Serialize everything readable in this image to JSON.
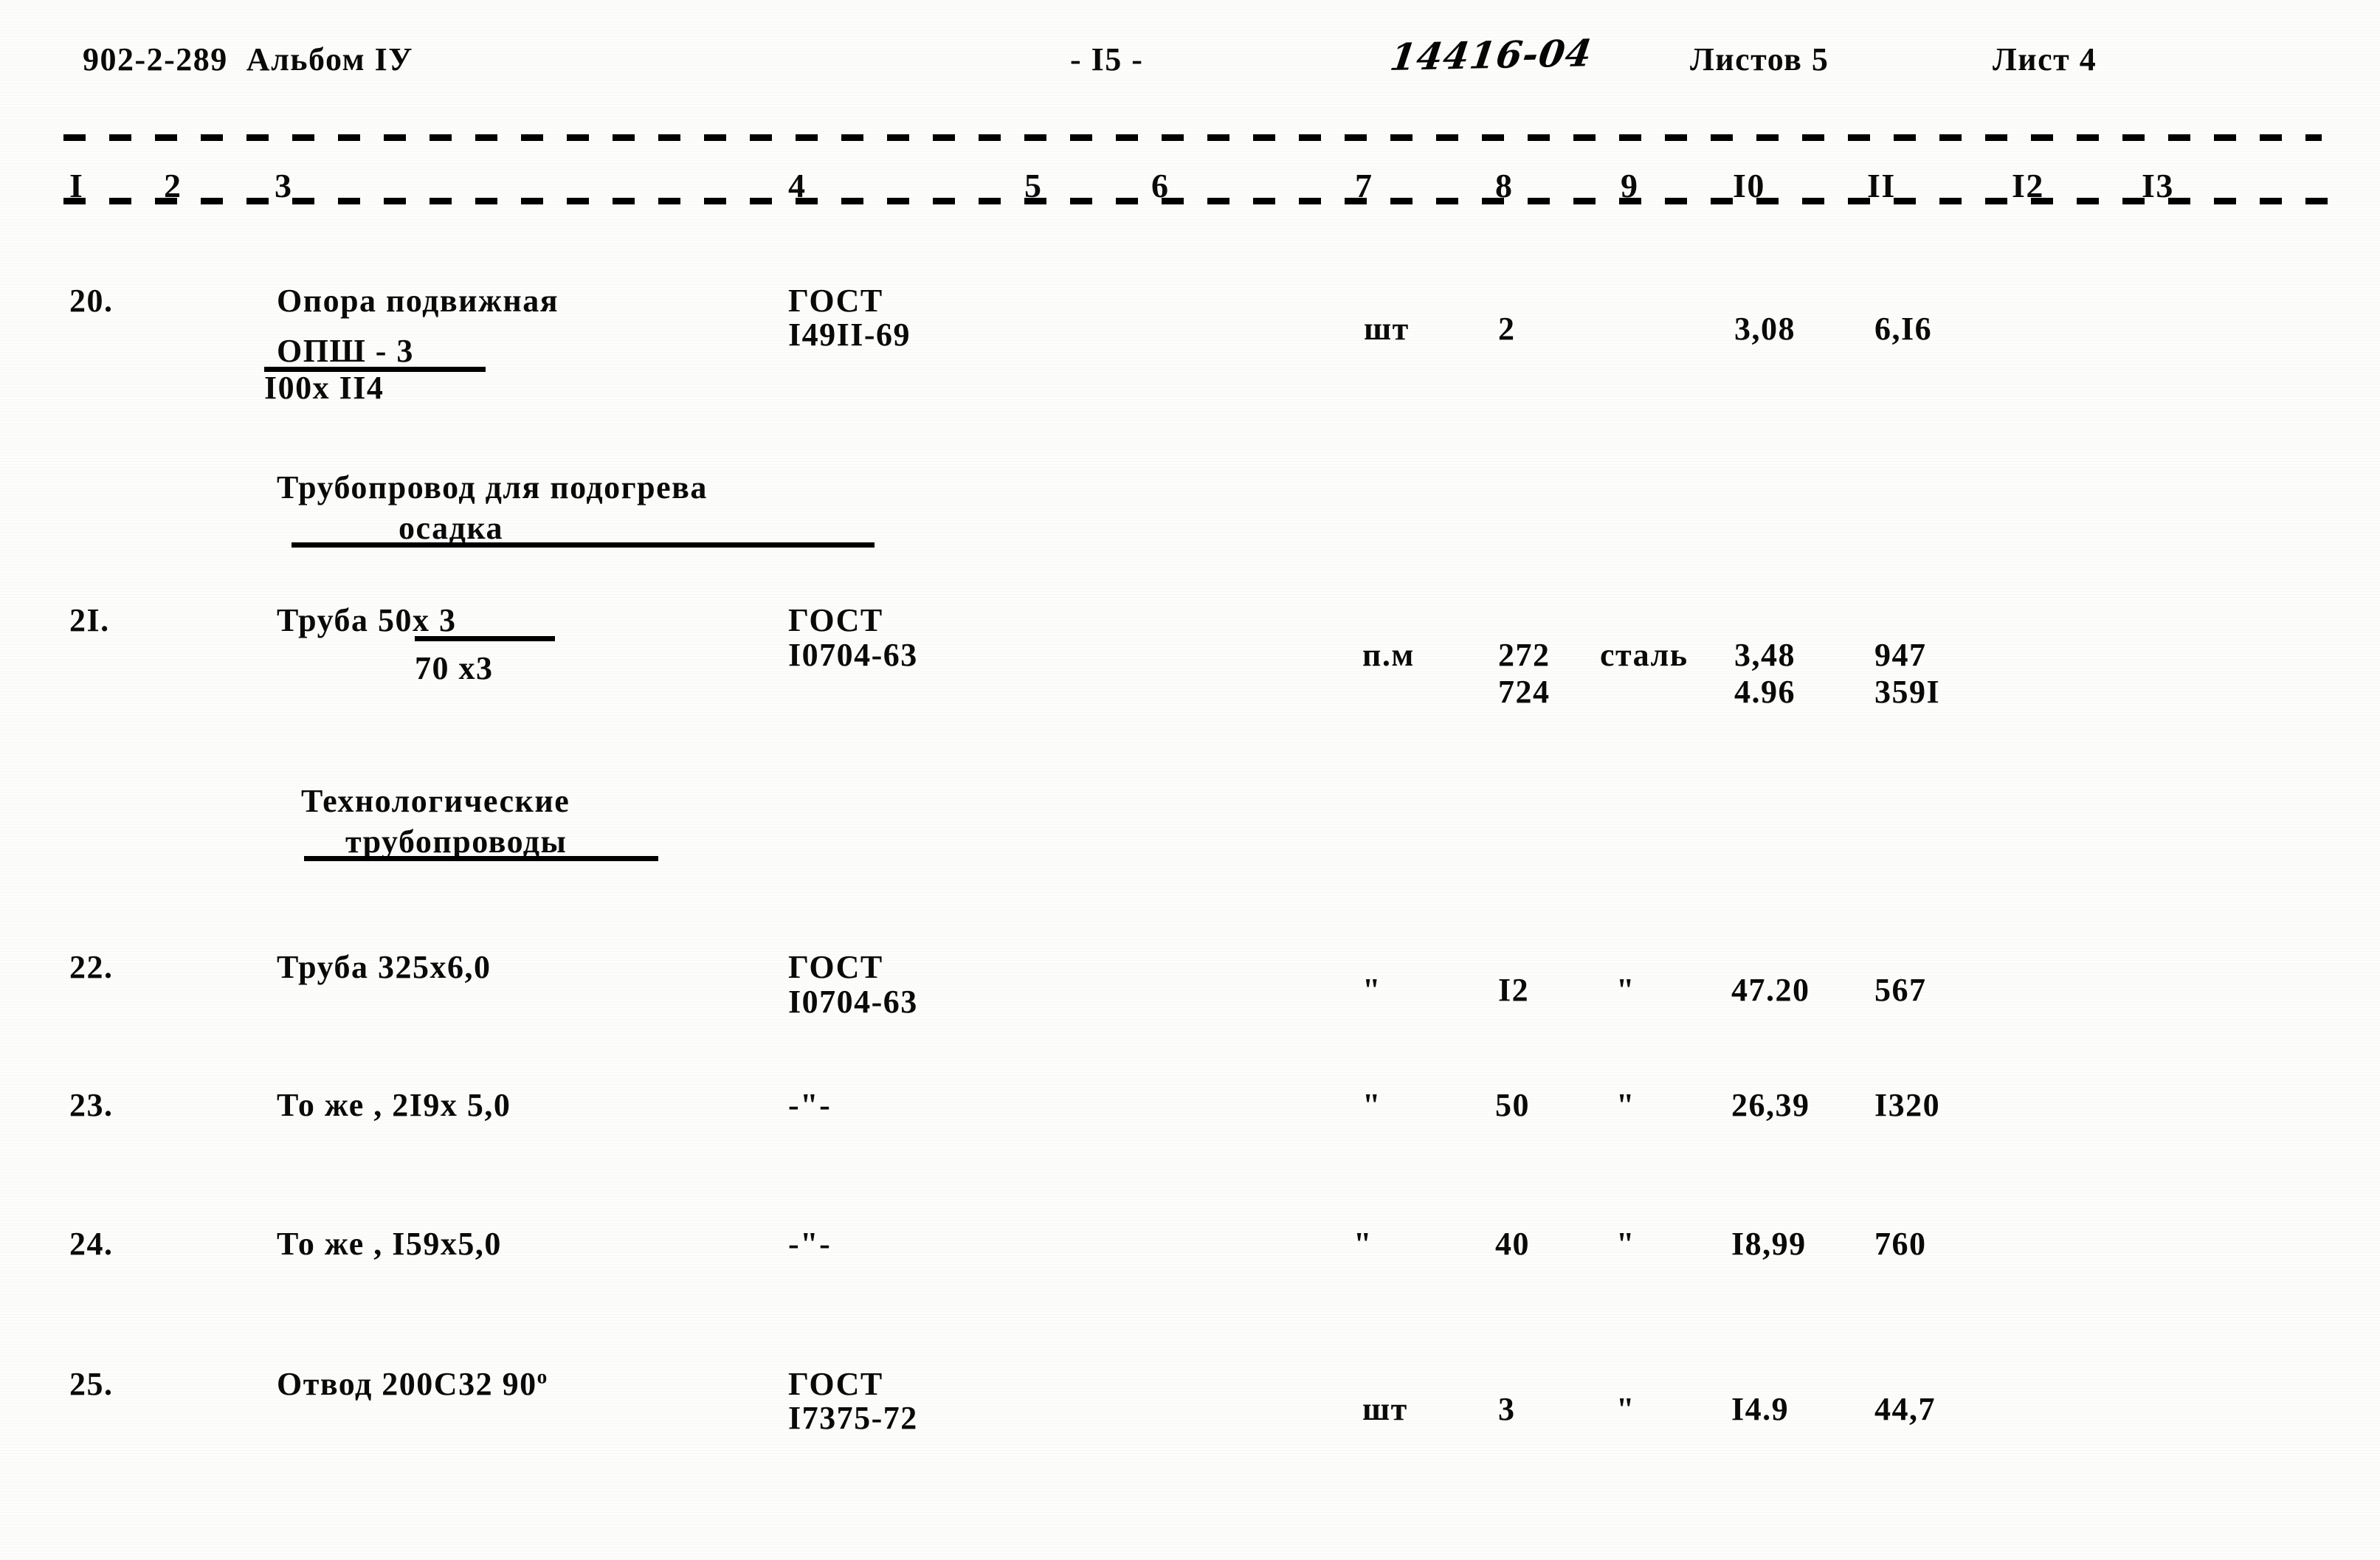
{
  "header": {
    "doc_code": "902-2-289  Альбом IУ",
    "page_marker": "- I5 -",
    "handwritten_code": "14416-04",
    "sheets_total": "Листов 5",
    "sheet_current": "Лист 4"
  },
  "column_numbers": [
    "I",
    "2",
    "3",
    "4",
    "5",
    "6",
    "7",
    "8",
    "9",
    "I0",
    "II",
    "I2",
    "I3"
  ],
  "section_headings": [
    {
      "line1": "Трубопровод для подогрева",
      "line2": "осадка"
    },
    {
      "line1": "Технологические",
      "line2": "трубопроводы"
    }
  ],
  "rows": [
    {
      "no": "20.",
      "name_line1": "Опора подвижная",
      "name_numerator": "ОПШ - 3",
      "name_denominator": "I00х II4",
      "gost_line1": "ГОСТ",
      "gost_line2": "I49II-69",
      "unit": "шт",
      "qty": "2",
      "material": "",
      "unit_weight": "3,08",
      "total_weight": "6,I6"
    },
    {
      "no": "2I.",
      "name_line1": "Труба 50х 3",
      "name_line2": "70 х3",
      "gost_line1": "ГОСТ",
      "gost_line2": "I0704-63",
      "unit": "п.м",
      "qty": "272",
      "qty2": "724",
      "material": "сталь",
      "unit_weight": "3,48",
      "unit_weight2": "4.96",
      "total_weight": "947",
      "total_weight2": "359I"
    },
    {
      "no": "22.",
      "name_line1": "Труба 325х6,0",
      "gost_line1": "ГОСТ",
      "gost_line2": "I0704-63",
      "unit": "\"",
      "qty": "I2",
      "material": "\"",
      "unit_weight": "47.20",
      "total_weight": "567"
    },
    {
      "no": "23.",
      "name_line1": "То же , 2I9х 5,0",
      "gost_line1": "-\"-",
      "unit": "\"",
      "qty": "50",
      "material": "\"",
      "unit_weight": "26,39",
      "total_weight": "I320"
    },
    {
      "no": "24.",
      "name_line1": "То же , I59х5,0",
      "gost_line1": "-\"-",
      "unit": "\"",
      "qty": "40",
      "material": "\"",
      "unit_weight": "I8,99",
      "total_weight": "760"
    },
    {
      "no": "25.",
      "name_line1": "Отвод 200С32 90",
      "name_sup": "о",
      "gost_line1": "ГОСТ",
      "gost_line2": "I7375-72",
      "unit": "шт",
      "qty": "3",
      "material": "\"",
      "unit_weight": "I4.9",
      "total_weight": "44,7"
    }
  ]
}
